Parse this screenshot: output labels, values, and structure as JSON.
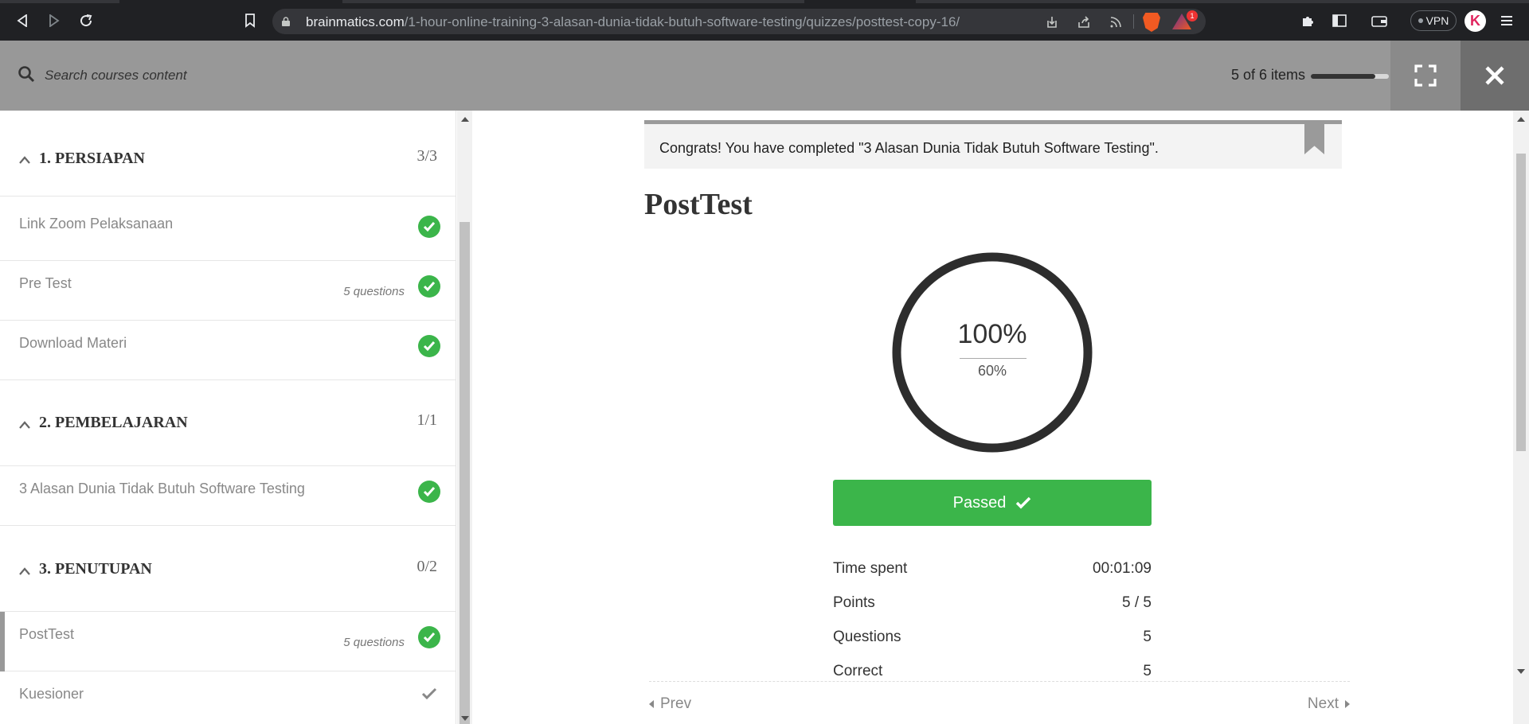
{
  "browser": {
    "url_domain": "brainmatics.com",
    "url_path": "/1-hour-online-training-3-alasan-dunia-tidak-butuh-software-testing/quizzes/posttest-copy-16/",
    "vpn_label": "VPN",
    "rewards_badge": "1",
    "profile_initial": "K"
  },
  "header": {
    "search_placeholder": "Search courses content",
    "items_count": "5 of 6 items",
    "progress_fraction": 0.83
  },
  "sidebar": {
    "sections": [
      {
        "title": "1. PERSIAPAN",
        "count": "3/3",
        "lessons": [
          {
            "name": "Link Zoom Pelaksanaan",
            "meta": "",
            "status": "done"
          },
          {
            "name": "Pre Test",
            "meta": "5 questions",
            "status": "done"
          },
          {
            "name": "Download Materi",
            "meta": "",
            "status": "done"
          }
        ]
      },
      {
        "title": "2. PEMBELAJARAN",
        "count": "1/1",
        "lessons": [
          {
            "name": "3 Alasan Dunia Tidak Butuh Software Testing",
            "meta": "",
            "status": "done"
          }
        ]
      },
      {
        "title": "3. PENUTUPAN",
        "count": "0/2",
        "lessons": [
          {
            "name": "PostTest",
            "meta": "5 questions",
            "status": "done"
          },
          {
            "name": "Kuesioner",
            "meta": "",
            "status": "incomplete"
          }
        ]
      }
    ]
  },
  "main": {
    "congrats_message": "Congrats! You have completed \"3 Alasan Dunia Tidak Butuh Software Testing\".",
    "quiz_title": "PostTest",
    "score": "100%",
    "passing_grade": "60%",
    "result_label": "Passed",
    "stats": [
      {
        "label": "Time spent",
        "value": "00:01:09"
      },
      {
        "label": "Points",
        "value": "5 / 5"
      },
      {
        "label": "Questions",
        "value": "5"
      },
      {
        "label": "Correct",
        "value": "5"
      }
    ],
    "prev_label": "Prev",
    "next_label": "Next"
  },
  "colors": {
    "success_green": "#3bb54a",
    "header_grey": "#989898",
    "browser_dark": "#202124"
  }
}
